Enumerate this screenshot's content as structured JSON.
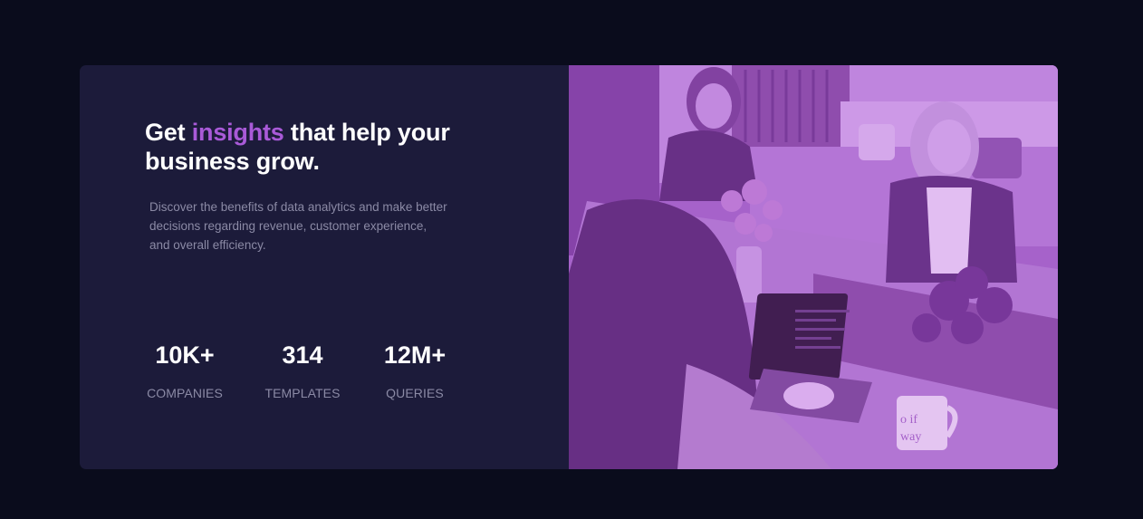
{
  "hero": {
    "title_start": "Get ",
    "title_accent": "insights",
    "title_end": " that help your business grow.",
    "description": "Discover the benefits of data analytics and make better decisions regarding revenue, customer experience, and overall efficiency."
  },
  "stats": [
    {
      "value": "10K+",
      "label": "COMPANIES"
    },
    {
      "value": "314",
      "label": "TEMPLATES"
    },
    {
      "value": "12M+",
      "label": "QUERIES"
    }
  ],
  "image": {
    "mug_text_1": "o if",
    "mug_text_2": "way"
  },
  "colors": {
    "page_background": "#0a0c1c",
    "card_background": "#1c1b3a",
    "accent": "#a95ad8",
    "muted_text": "#8b8aa5",
    "image_tint": "#a461c9"
  }
}
